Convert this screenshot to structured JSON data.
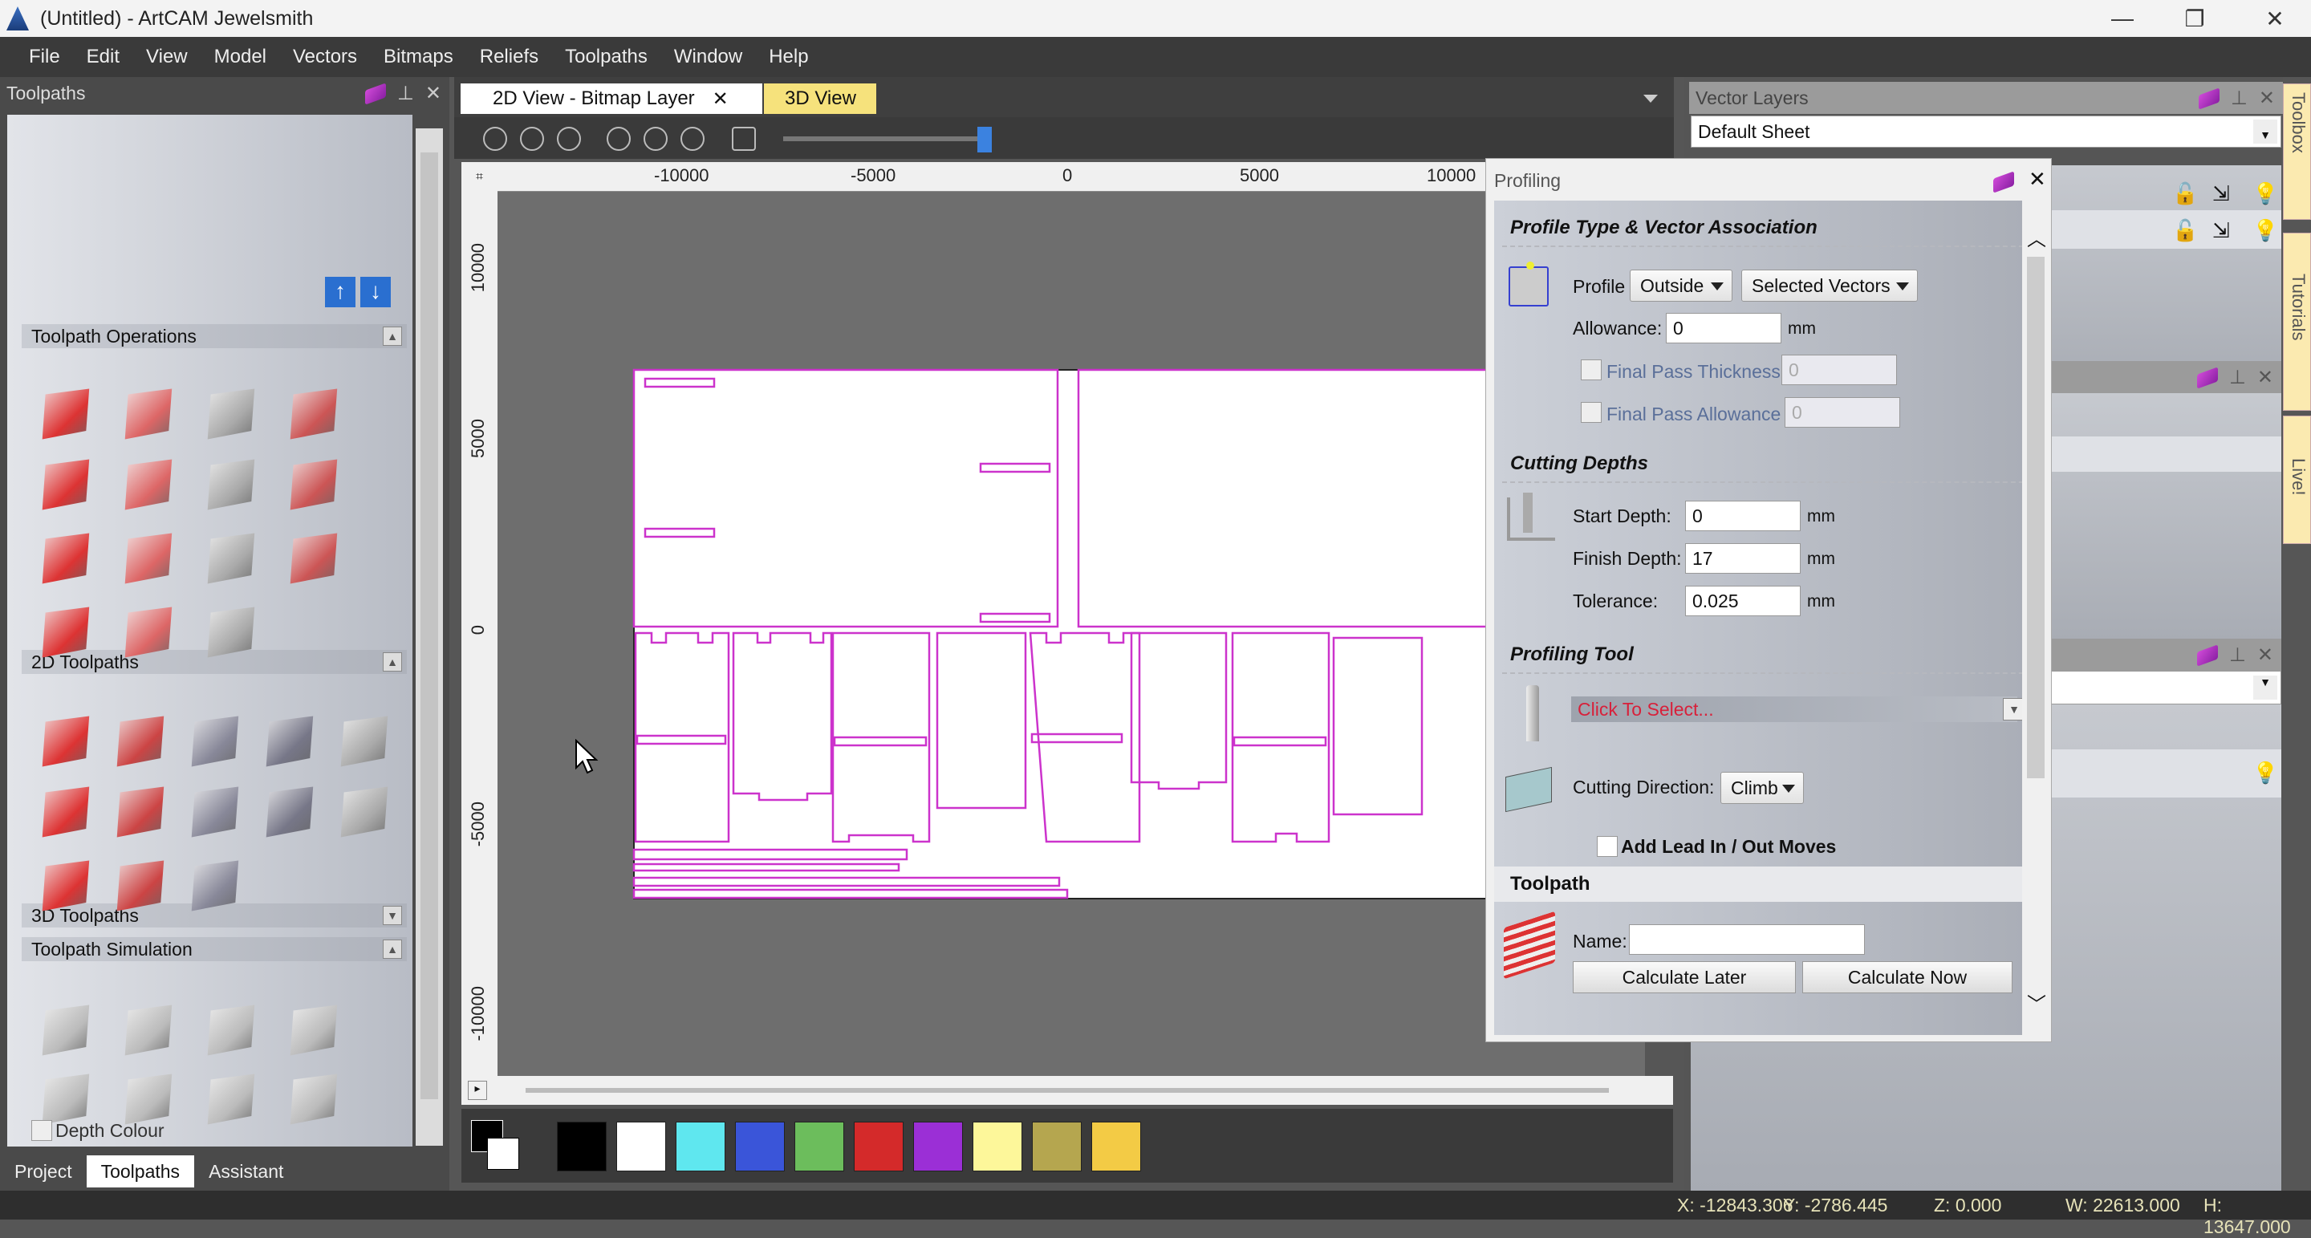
{
  "window": {
    "title": "(Untitled) - ArtCAM Jewelsmith",
    "minimize": "—",
    "restore": "❐",
    "close": "✕"
  },
  "menu": [
    "File",
    "Edit",
    "View",
    "Model",
    "Vectors",
    "Bitmaps",
    "Reliefs",
    "Toolpaths",
    "Window",
    "Help"
  ],
  "left_panel": {
    "title": "Toolpaths",
    "sections": {
      "ops": "Toolpath Operations",
      "2d": "2D Toolpaths",
      "3d": "3D Toolpaths",
      "sim": "Toolpath Simulation"
    },
    "depth_colour": "Depth Colour",
    "tabs": [
      "Project",
      "Toolpaths",
      "Assistant"
    ]
  },
  "doc_tabs": [
    {
      "label": "2D View - Bitmap Layer",
      "active": true
    },
    {
      "label": "3D View",
      "active": false
    }
  ],
  "ruler": {
    "x": [
      "-10000",
      "-5000",
      "0",
      "5000",
      "10000"
    ],
    "y": [
      "10000",
      "5000",
      "0",
      "-5000",
      "-10000"
    ]
  },
  "palette": [
    "#000000",
    "#ffffff",
    "#5fe7ef",
    "#3a55d9",
    "#6cbd5c",
    "#d42a2a",
    "#9b2fd6",
    "#fdf79a",
    "#b5a64f",
    "#f3cb45"
  ],
  "vector_color": "#cc33cc",
  "profiling": {
    "title": "Profiling",
    "section1": "Profile Type & Vector Association",
    "profile_label": "Profile",
    "profile_type": "Outside",
    "vector_assoc": "Selected Vectors",
    "allowance_label": "Allowance:",
    "allowance": "0",
    "unit": "mm",
    "fpt_label": "Final Pass Thickness",
    "fpt": "0",
    "fpa_label": "Final Pass Allowance",
    "fpa": "0",
    "section2": "Cutting Depths",
    "start_label": "Start Depth:",
    "start": "0",
    "finish_label": "Finish Depth:",
    "finish": "17",
    "tol_label": "Tolerance:",
    "tol": "0.025",
    "section3": "Profiling Tool",
    "tool": "Click To Select...",
    "dir_label": "Cutting Direction:",
    "dir": "Climb",
    "leadin": "Add Lead In / Out Moves",
    "section4": "Toolpath",
    "name_label": "Name:",
    "name": "",
    "calc_later": "Calculate Later",
    "calc_now": "Calculate Now"
  },
  "vector_layers": {
    "title": "Vector Layers",
    "sheet": "Default Sheet"
  },
  "side_tabs": [
    "Toolbox",
    "Tutorials",
    "Live!"
  ],
  "status": {
    "x": "X: -12843.306",
    "y": "Y: -2786.445",
    "z": "Z: 0.000",
    "w": "W: 22613.000",
    "h": "H: 13647.000"
  }
}
